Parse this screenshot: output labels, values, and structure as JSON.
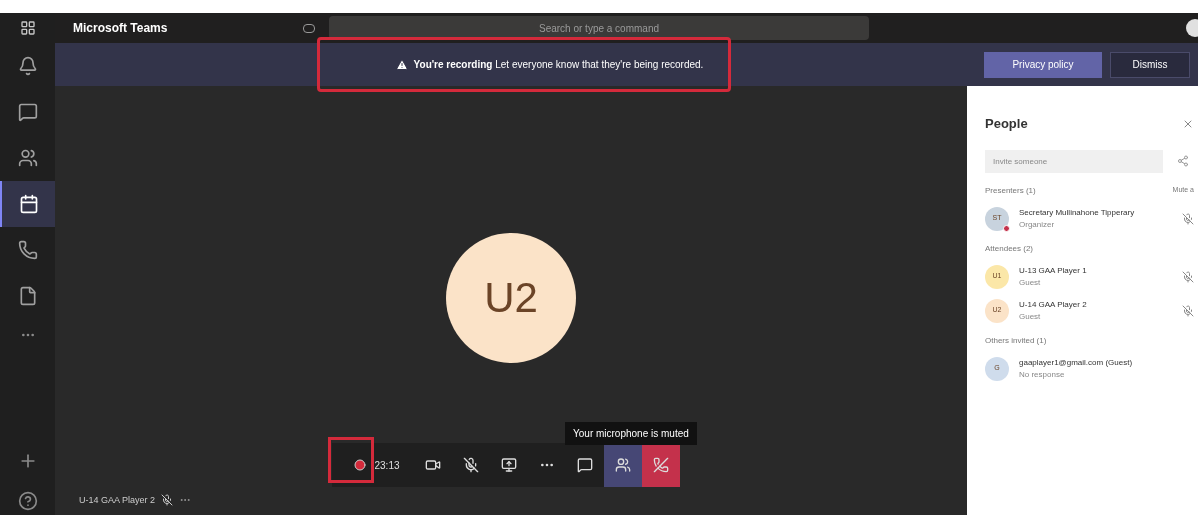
{
  "app": {
    "title": "Microsoft Teams"
  },
  "search": {
    "placeholder": "Search or type a command"
  },
  "rail": [
    {
      "selected": false
    },
    {
      "selected": false
    },
    {
      "selected": false
    },
    {
      "selected": true
    },
    {
      "selected": false
    },
    {
      "selected": false
    }
  ],
  "banner": {
    "title": "You're recording",
    "message": "Let everyone know that they're being recorded.",
    "buttons": [
      {
        "label": "Privacy policy",
        "kind": "primary"
      },
      {
        "label": "Dismiss",
        "kind": "secondary"
      }
    ]
  },
  "stage": {
    "avatar": "U2",
    "tooltip": "Your microphone is muted",
    "participant": "U-14 GAA Player 2"
  },
  "controls": {
    "timer": "23:13",
    "buttons": [
      {
        "selected": false
      },
      {
        "selected": false
      },
      {
        "selected": false
      },
      {
        "selected": false
      },
      {
        "selected": false
      },
      {
        "selected": true
      }
    ]
  },
  "people": {
    "title": "People",
    "invite_placeholder": "Invite someone",
    "sections": [
      {
        "title": "Presenters (1)",
        "action": "Mute a",
        "members": [
          {
            "initials": "ST",
            "name": "Secretary Mullinahone Tipperary",
            "role": "Organizer",
            "color": "#c8d3de",
            "status_dot": true
          }
        ]
      },
      {
        "title": "Attendees (2)",
        "members": [
          {
            "initials": "U1",
            "name": "U-13 GAA Player 1",
            "role": "Guest",
            "color": "#fbe7a8",
            "status_dot": false
          },
          {
            "initials": "U2",
            "name": "U-14 GAA Player 2",
            "role": "Guest",
            "color": "#fbe3c8",
            "status_dot": false
          }
        ]
      },
      {
        "title": "Others invited (1)",
        "members": [
          {
            "initials": "G",
            "name": "gaaplayer1@gmail.com (Guest)",
            "role": "No response",
            "color": "#cfdcec",
            "status_dot": false
          }
        ]
      }
    ]
  }
}
